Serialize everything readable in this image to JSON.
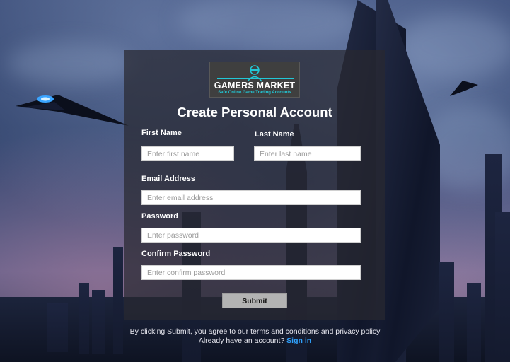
{
  "brand": {
    "name": "GAMERS MARKET",
    "tagline": "Safe Online Game Trading Accounts",
    "logo_icon": "gamer-avatar-icon",
    "accent": "#22c7d6"
  },
  "form": {
    "title": "Create Personal Account",
    "first_name": {
      "label": "First Name",
      "placeholder": "Enter first name",
      "value": ""
    },
    "last_name": {
      "label": "Last Name",
      "placeholder": "Enter last name",
      "value": ""
    },
    "email": {
      "label": "Email Address",
      "placeholder": "Enter email address",
      "value": ""
    },
    "password": {
      "label": "Password",
      "placeholder": "Enter password",
      "value": ""
    },
    "confirm_password": {
      "label": "Confirm Password",
      "placeholder": "Enter confirm password",
      "value": ""
    },
    "submit_label": "Submit"
  },
  "footer": {
    "terms_text": "By clicking Submit, you agree to our terms and conditions and privacy policy",
    "have_account_text": "Already have an account?",
    "signin_link": "Sign in",
    "link_color": "#2fa3ff"
  },
  "colors": {
    "panel_bg": "rgba(40,40,48,0.72)",
    "button_bg": "#b3b3b3"
  }
}
